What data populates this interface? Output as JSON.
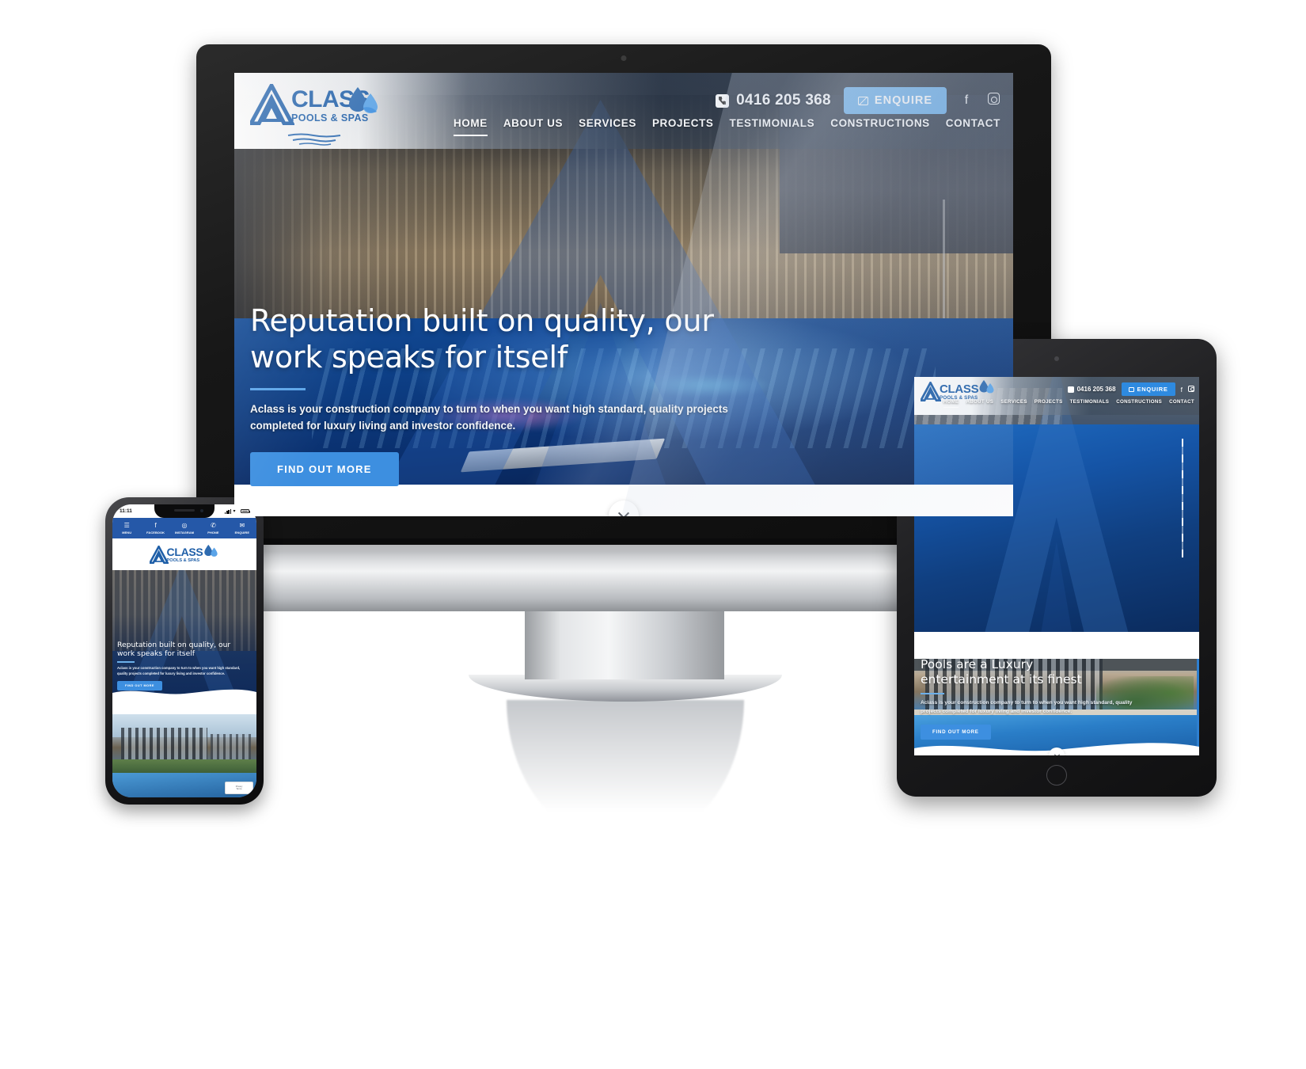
{
  "brand": {
    "logo_letter": "A",
    "name": "CLASS",
    "tagline": "POOLS & SPAS",
    "accent_blue": "#1f5fa8",
    "button_blue": "#3d8fe0",
    "header_button_blue": "#6cb0ea",
    "nav_bar_blue": "#2558a8"
  },
  "desktop": {
    "header": {
      "phone_number": "0416 205 368",
      "phone_icon": "phone-icon",
      "enquire_label": "ENQUIRE",
      "enquire_icon": "envelope-icon",
      "facebook_icon": "facebook-icon",
      "instagram_icon": "instagram-icon"
    },
    "nav": [
      {
        "label": "HOME",
        "active": true
      },
      {
        "label": "ABOUT US",
        "active": false
      },
      {
        "label": "SERVICES",
        "active": false
      },
      {
        "label": "PROJECTS",
        "active": false
      },
      {
        "label": "TESTIMONIALS",
        "active": false
      },
      {
        "label": "CONSTRUCTIONS",
        "active": false
      },
      {
        "label": "CONTACT",
        "active": false
      }
    ],
    "hero": {
      "headline_line1": "Reputation built on quality, our",
      "headline_line2": "work speaks for itself",
      "paragraph": "Aclass is your construction company to turn to when you want high standard, quality projects completed for luxury living and investor confidence.",
      "cta_label": "FIND OUT MORE",
      "scroll_icon": "chevron-down-icon"
    }
  },
  "tablet": {
    "header": {
      "phone_number": "0416 205 368",
      "enquire_label": "ENQUIRE"
    },
    "nav": [
      {
        "label": "HOME",
        "active": true
      },
      {
        "label": "ABOUT US",
        "active": false
      },
      {
        "label": "SERVICES",
        "active": false
      },
      {
        "label": "PROJECTS",
        "active": false
      },
      {
        "label": "TESTIMONIALS",
        "active": false
      },
      {
        "label": "CONSTRUCTIONS",
        "active": false
      },
      {
        "label": "CONTACT",
        "active": false
      }
    ],
    "hero": {
      "headline_line1": "Pools are a Luxury",
      "headline_line2": "entertainment at its finest",
      "paragraph": "Aclass is your construction company to turn to when you want high standard, quality projects completed for luxury living and investor confidence.",
      "cta_label": "FIND OUT MORE",
      "scroll_icon": "chevron-down-icon"
    }
  },
  "phone": {
    "status_bar": {
      "time": "11:11",
      "signal_icon": "cellular-signal-icon",
      "wifi_icon": "wifi-icon",
      "battery_icon": "battery-icon"
    },
    "nav": [
      {
        "label": "MENU",
        "icon": "hamburger-menu-icon",
        "glyph": "☰"
      },
      {
        "label": "FACEBOOK",
        "icon": "facebook-icon",
        "glyph": "f"
      },
      {
        "label": "INSTAGRAM",
        "icon": "instagram-icon",
        "glyph": "◎"
      },
      {
        "label": "PHONE",
        "icon": "phone-icon",
        "glyph": "✆"
      },
      {
        "label": "ENQUIRE",
        "icon": "envelope-icon",
        "glyph": "✉"
      }
    ],
    "hero": {
      "headline_line1": "Reputation built on quality, our",
      "headline_line2": "work speaks for itself",
      "paragraph": "Aclass is your construction company to turn to when you want high standard, quality projects completed for luxury living and investor confidence.",
      "cta_label": "FIND OUT MORE"
    },
    "recaptcha": {
      "line1": "Privacy",
      "line2": "Terms"
    }
  }
}
